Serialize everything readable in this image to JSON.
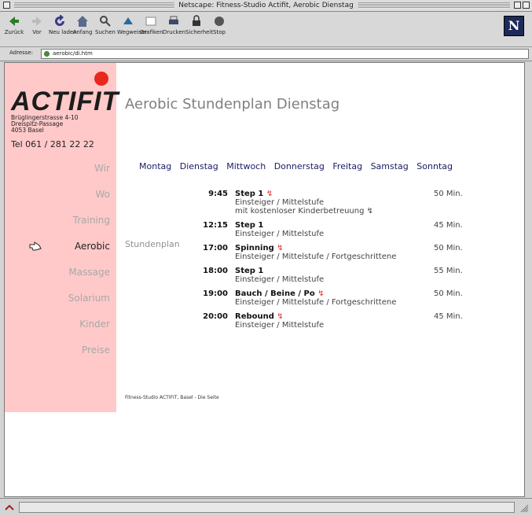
{
  "window": {
    "title": "Netscape: Fitness-Studio Actifit, Aerobic Dienstag"
  },
  "toolbar": {
    "buttons": [
      {
        "label": "Zurück",
        "icon": "back-arrow-icon"
      },
      {
        "label": "Vor",
        "icon": "forward-arrow-icon"
      },
      {
        "label": "Neu laden",
        "icon": "reload-icon"
      },
      {
        "label": "Anfang",
        "icon": "home-icon"
      },
      {
        "label": "Suchen",
        "icon": "search-icon"
      },
      {
        "label": "Wegweiser",
        "icon": "guide-icon"
      },
      {
        "label": "Grafiken",
        "icon": "images-icon"
      },
      {
        "label": "Drucken",
        "icon": "print-icon"
      },
      {
        "label": "Sicherheit",
        "icon": "security-icon"
      },
      {
        "label": "Stop",
        "icon": "stop-icon"
      }
    ],
    "logo_letter": "N"
  },
  "location": {
    "label": "Adresse:",
    "url": "aerobic/di.htm"
  },
  "site": {
    "logo": "ACTIFIT",
    "address_lines": [
      "Brüglingerstrasse 4-10",
      "Dreispitz-Passage",
      "4053 Basel"
    ],
    "phone": "Tel 061 / 281 22 22",
    "heading": "Aerobic Stundenplan Dienstag",
    "side_label": "Stundenplan",
    "footer": "Fitness-Studio ACTIFIT, Basel - Die Seite",
    "accent": "#ffc9c9",
    "logo_dot_color": "#e8281e"
  },
  "nav": {
    "items": [
      "Wir",
      "Wo",
      "Training",
      "Aerobic",
      "Massage",
      "Solarium",
      "Kinder",
      "Preise"
    ],
    "active": "Aerobic"
  },
  "days": [
    "Montag",
    "Dienstag",
    "Mittwoch",
    "Donnerstag",
    "Freitag",
    "Samstag",
    "Sonntag"
  ],
  "schedule": [
    {
      "time": "9:45",
      "name": "Step 1",
      "mark": "↯",
      "lines": [
        "Einsteiger / Mittelstufe",
        "mit kostenloser Kinderbetreuung ↯"
      ],
      "duration": "50 Min."
    },
    {
      "time": "12:15",
      "name": "Step 1",
      "mark": "",
      "lines": [
        "Einsteiger / Mittelstufe"
      ],
      "duration": "45 Min."
    },
    {
      "time": "17:00",
      "name": "Spinning",
      "mark": "↯",
      "lines": [
        "Einsteiger / Mittelstufe / Fortgeschrittene"
      ],
      "duration": "50 Min."
    },
    {
      "time": "18:00",
      "name": "Step 1",
      "mark": "",
      "lines": [
        "Einsteiger / Mittelstufe"
      ],
      "duration": "55 Min."
    },
    {
      "time": "19:00",
      "name": "Bauch / Beine / Po",
      "mark": "↯",
      "lines": [
        "Einsteiger / Mittelstufe / Fortgeschrittene"
      ],
      "duration": "50 Min."
    },
    {
      "time": "20:00",
      "name": "Rebound",
      "mark": "↯",
      "lines": [
        "Einsteiger / Mittelstufe"
      ],
      "duration": "45 Min."
    }
  ]
}
